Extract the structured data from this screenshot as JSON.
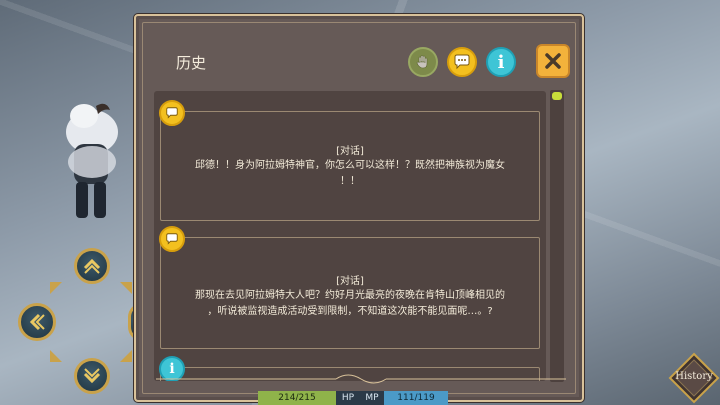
{
  "dialog": {
    "title": "历史",
    "filters": [
      {
        "name": "hand-icon"
      },
      {
        "name": "chat-icon"
      },
      {
        "name": "info-icon",
        "glyph": "i"
      }
    ],
    "close_icon": "close-icon"
  },
  "entries": [
    {
      "icon": "chat-icon",
      "type": "[对话]",
      "lines": [
        "邱德！！身为阿拉姆特神官，你怎么可以这样！？既然把神族视为魔女",
        "！！"
      ]
    },
    {
      "icon": "chat-icon",
      "type": "[对话]",
      "lines": [
        "那现在去见阿拉姆特大人吧？约好月光最亮的夜晚在肯特山顶峰相见的",
        "，听说被监视造成活动受到限制，不知道这次能不能见面呢…。?"
      ]
    },
    {
      "icon": "info-icon",
      "glyph": "i"
    }
  ],
  "status": {
    "hp_value": "214/215",
    "hp_label": "HP",
    "mp_label": "MP",
    "mp_value": "111/119"
  },
  "history_button": {
    "label": "History"
  },
  "colors": {
    "panel": "#665a57",
    "list_bg": "#504441",
    "border_gold": "#d9c29a",
    "chat_yellow": "#f3c01f",
    "info_cyan": "#3ec5d6",
    "close_orange": "#f3b23b",
    "scroll_thumb": "#c8de3a"
  }
}
